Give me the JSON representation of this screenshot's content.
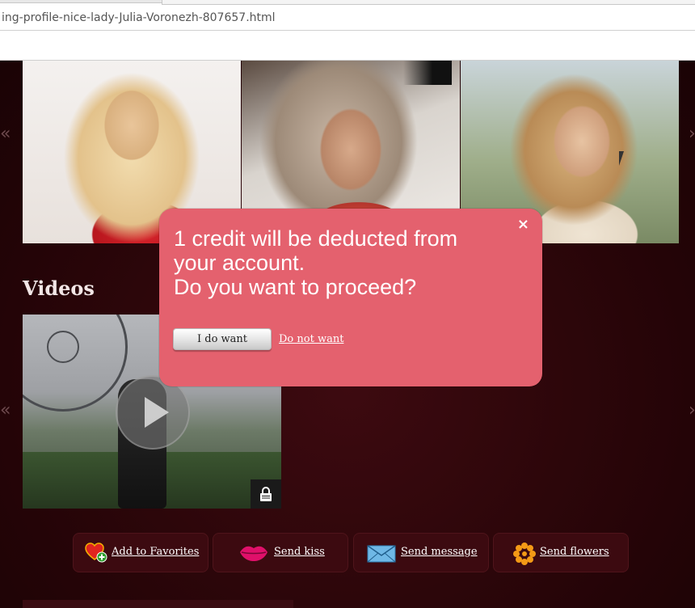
{
  "browser": {
    "url": "ing-profile-nice-lady-Julia-Voronezh-807657.html"
  },
  "sections": {
    "videos_title": "Videos"
  },
  "modal": {
    "close_glyph": "×",
    "message_line1": "1 credit will be deducted from",
    "message_line2": "your account.",
    "message_line3": "Do you want to proceed?",
    "confirm_label": "I do want",
    "decline_label": "Do not want",
    "bg_color": "#e4616e"
  },
  "actions": {
    "favorites_label": "Add to Favorites",
    "kiss_label": "Send kiss",
    "message_label": "Send message",
    "flowers_label": "Send flowers"
  },
  "colors": {
    "page_bg": "#2a0509",
    "action_bg": "#3c0a10"
  }
}
